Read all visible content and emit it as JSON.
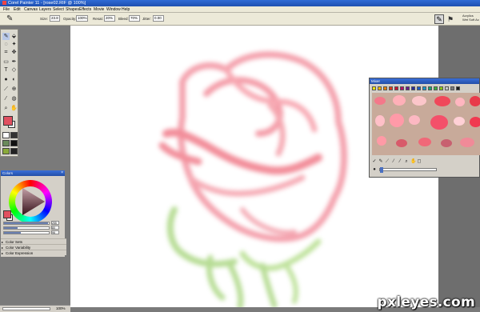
{
  "window": {
    "title": "Corel Painter 11 - [rose02.RIF @ 100%]"
  },
  "menu": [
    "File",
    "Edit",
    "Canvas",
    "Layers",
    "Select",
    "Shapes",
    "Effects",
    "Movie",
    "Window",
    "Help"
  ],
  "property_bar": {
    "size_label": "Size:",
    "size_value": "23.8",
    "opacity_label": "Opacity:",
    "opacity_value": "100%",
    "resat_label": "Resat:",
    "resat_value": "20%",
    "bleed_label": "Bleed:",
    "bleed_value": "70%",
    "jitter_label": "Jitter:",
    "jitter_value": "0.00",
    "brush_category": "Acrylics",
    "brush_variant": "Wet Soft Ac"
  },
  "toolbox": {
    "tools": [
      "brush-icon",
      "dropper-icon",
      "lasso-icon",
      "magic-wand-icon",
      "crop-icon",
      "transform-icon",
      "rectangle-icon",
      "pen-icon",
      "text-icon",
      "shape-icon",
      "dodge-icon",
      "burn-icon",
      "rubber-icon",
      "cloner-icon",
      "eyedropper-icon",
      "fill-icon",
      "magnifier-icon",
      "grabber-icon"
    ],
    "main_color": "#e05060",
    "additional_color": "#ffffff"
  },
  "colors_panel": {
    "title": "Colors",
    "values": [
      "255",
      "80",
      "96"
    ],
    "sections": [
      "Color Sets",
      "Color Variability",
      "Color Expression"
    ]
  },
  "mixer": {
    "title": "Mixer",
    "swatch_colors": [
      "#f2e600",
      "#f7b800",
      "#e98000",
      "#d83a1c",
      "#c81234",
      "#b4106a",
      "#6a1a8a",
      "#2a2a9a",
      "#1a5ac8",
      "#1a9ad0",
      "#1aa870",
      "#3ab23a",
      "#8ac61a",
      "#c8c8c8",
      "#7a7a7a",
      "#1a1a1a"
    ],
    "pad_color": "#c8aa9a"
  },
  "status": {
    "zoom": "100%"
  },
  "watermark": "pxleyes.com"
}
